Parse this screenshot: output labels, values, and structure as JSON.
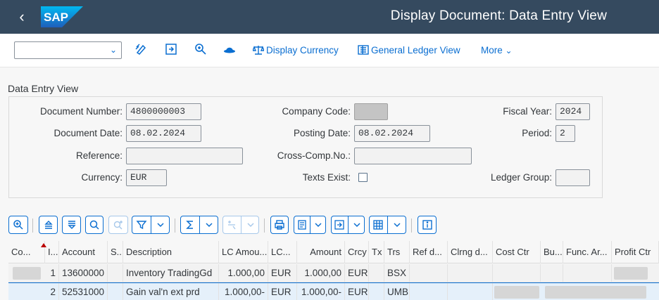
{
  "shell": {
    "title": "Display Document: Data Entry View",
    "logo_text": "SAP"
  },
  "toolbar": {
    "dropdown_value": "",
    "display_currency": "Display Currency",
    "general_ledger_view": "General Ledger View",
    "more": "More"
  },
  "section": {
    "title": "Data Entry View"
  },
  "header_fields": {
    "document_number_label": "Document Number:",
    "document_number": "4800000003",
    "company_code_label": "Company Code:",
    "company_code": "",
    "fiscal_year_label": "Fiscal Year:",
    "fiscal_year": "2024",
    "document_date_label": "Document Date:",
    "document_date": "08.02.2024",
    "posting_date_label": "Posting Date:",
    "posting_date": "08.02.2024",
    "period_label": "Period:",
    "period": "2",
    "reference_label": "Reference:",
    "reference": "",
    "cross_comp_label": "Cross-Comp.No.:",
    "cross_comp": "",
    "currency_label": "Currency:",
    "currency": "EUR",
    "texts_exist_label": "Texts Exist:",
    "texts_exist": false,
    "ledger_group_label": "Ledger Group:",
    "ledger_group": ""
  },
  "table": {
    "columns": [
      "Co...",
      "I...",
      "Account",
      "S...",
      "Description",
      "LC Amou...",
      "LC...",
      "Amount",
      "Crcy",
      "Tx",
      "Trs",
      "Ref d...",
      "Clrng d...",
      "Cost Ctr",
      "Bu...",
      "Func. Ar...",
      "Profit Ctr"
    ],
    "rows": [
      {
        "co": "",
        "item": "1",
        "account": "13600000",
        "s": "",
        "description": "Inventory TradingGd",
        "lc_amount": "1.000,00",
        "lc_crcy": "EUR",
        "amount": "1.000,00",
        "crcy": "EUR",
        "tx": "",
        "trs": "BSX",
        "ref_d": "",
        "clrng_d": "",
        "cost_ctr": "",
        "bu": "",
        "func_ar": "",
        "profit_ctr": ""
      },
      {
        "co": "",
        "item": "2",
        "account": "52531000",
        "s": "",
        "description": "Gain val'n ext prd",
        "lc_amount": "1.000,00-",
        "lc_crcy": "EUR",
        "amount": "1.000,00-",
        "crcy": "EUR",
        "tx": "",
        "trs": "UMB",
        "ref_d": "",
        "clrng_d": "",
        "cost_ctr": "",
        "bu": "",
        "func_ar": "",
        "profit_ctr": ""
      }
    ]
  },
  "colors": {
    "shell_bg": "#354a5f",
    "accent": "#0a6ed1",
    "selected_row": "#e5f0fa"
  }
}
